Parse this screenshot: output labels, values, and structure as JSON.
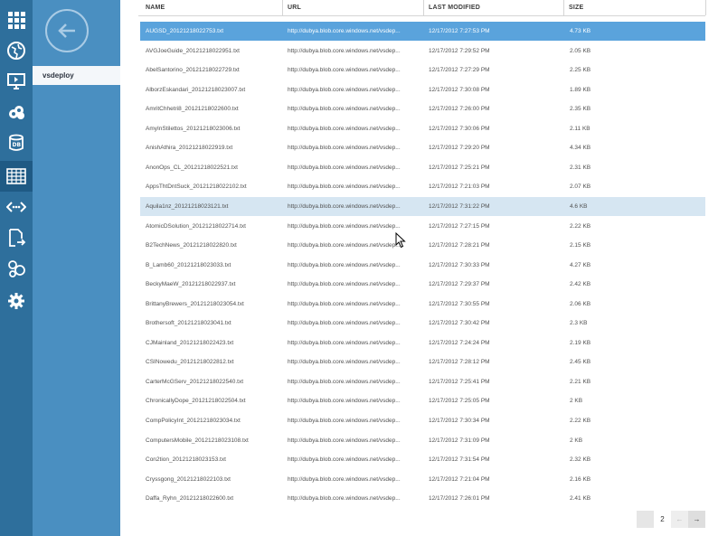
{
  "nav": {
    "items": [
      {
        "name": "all-items-icon"
      },
      {
        "name": "web-sites-icon"
      },
      {
        "name": "virtual-machines-icon"
      },
      {
        "name": "cloud-services-icon"
      },
      {
        "name": "sql-databases-icon"
      },
      {
        "name": "storage-icon"
      },
      {
        "name": "networks-icon"
      },
      {
        "name": "import-export-icon"
      },
      {
        "name": "hdinsight-icon"
      },
      {
        "name": "settings-icon"
      }
    ]
  },
  "sidebar": {
    "selected_item": "vsdeploy"
  },
  "table": {
    "columns": [
      "NAME",
      "URL",
      "LAST MODIFIED",
      "SIZE"
    ],
    "rows": [
      {
        "name": "AUGSD_20121218022753.txt",
        "url": "http://dubya.blob.core.windows.net/vsdep...",
        "modified": "12/17/2012 7:27:53 PM",
        "size": "4.73 KB"
      },
      {
        "name": "AVGJoeGuide_20121218022951.txt",
        "url": "http://dubya.blob.core.windows.net/vsdep...",
        "modified": "12/17/2012 7:29:52 PM",
        "size": "2.05 KB"
      },
      {
        "name": "AbelSantorino_20121218022729.txt",
        "url": "http://dubya.blob.core.windows.net/vsdep...",
        "modified": "12/17/2012 7:27:29 PM",
        "size": "2.25 KB"
      },
      {
        "name": "AlborzEskandari_20121218023007.txt",
        "url": "http://dubya.blob.core.windows.net/vsdep...",
        "modified": "12/17/2012 7:30:08 PM",
        "size": "1.89 KB"
      },
      {
        "name": "AmritChhetri8_20121218022600.txt",
        "url": "http://dubya.blob.core.windows.net/vsdep...",
        "modified": "12/17/2012 7:26:00 PM",
        "size": "2.35 KB"
      },
      {
        "name": "AmyInStilettos_20121218023006.txt",
        "url": "http://dubya.blob.core.windows.net/vsdep...",
        "modified": "12/17/2012 7:30:06 PM",
        "size": "2.11 KB"
      },
      {
        "name": "AnishAthira_20121218022919.txt",
        "url": "http://dubya.blob.core.windows.net/vsdep...",
        "modified": "12/17/2012 7:29:20 PM",
        "size": "4.34 KB"
      },
      {
        "name": "AnonOps_CL_20121218022521.txt",
        "url": "http://dubya.blob.core.windows.net/vsdep...",
        "modified": "12/17/2012 7:25:21 PM",
        "size": "2.31 KB"
      },
      {
        "name": "AppsThtDntSuck_20121218022102.txt",
        "url": "http://dubya.blob.core.windows.net/vsdep...",
        "modified": "12/17/2012 7:21:03 PM",
        "size": "2.07 KB"
      },
      {
        "name": "Aquila1nz_20121218023121.txt",
        "url": "http://dubya.blob.core.windows.net/vsdep...",
        "modified": "12/17/2012 7:31:22 PM",
        "size": "4.6 KB"
      },
      {
        "name": "AtomicDSolution_20121218022714.txt",
        "url": "http://dubya.blob.core.windows.net/vsdep...",
        "modified": "12/17/2012 7:27:15 PM",
        "size": "2.22 KB"
      },
      {
        "name": "B2TechNews_20121218022820.txt",
        "url": "http://dubya.blob.core.windows.net/vsdep...",
        "modified": "12/17/2012 7:28:21 PM",
        "size": "2.15 KB"
      },
      {
        "name": "B_Lamb60_20121218023033.txt",
        "url": "http://dubya.blob.core.windows.net/vsdep...",
        "modified": "12/17/2012 7:30:33 PM",
        "size": "4.27 KB"
      },
      {
        "name": "BeckyMaeW_20121218022937.txt",
        "url": "http://dubya.blob.core.windows.net/vsdep...",
        "modified": "12/17/2012 7:29:37 PM",
        "size": "2.42 KB"
      },
      {
        "name": "BrittanyBrewers_20121218023054.txt",
        "url": "http://dubya.blob.core.windows.net/vsdep...",
        "modified": "12/17/2012 7:30:55 PM",
        "size": "2.06 KB"
      },
      {
        "name": "Brothersoft_20121218023041.txt",
        "url": "http://dubya.blob.core.windows.net/vsdep...",
        "modified": "12/17/2012 7:30:42 PM",
        "size": "2.3 KB"
      },
      {
        "name": "CJMainland_20121218022423.txt",
        "url": "http://dubya.blob.core.windows.net/vsdep...",
        "modified": "12/17/2012 7:24:24 PM",
        "size": "2.19 KB"
      },
      {
        "name": "CSINowedu_20121218022812.txt",
        "url": "http://dubya.blob.core.windows.net/vsdep...",
        "modified": "12/17/2012 7:28:12 PM",
        "size": "2.45 KB"
      },
      {
        "name": "CarterMcGServ_20121218022540.txt",
        "url": "http://dubya.blob.core.windows.net/vsdep...",
        "modified": "12/17/2012 7:25:41 PM",
        "size": "2.21 KB"
      },
      {
        "name": "ChronicallyDope_20121218022504.txt",
        "url": "http://dubya.blob.core.windows.net/vsdep...",
        "modified": "12/17/2012 7:25:05 PM",
        "size": "2 KB"
      },
      {
        "name": "CompPolicyInt_20121218023034.txt",
        "url": "http://dubya.blob.core.windows.net/vsdep...",
        "modified": "12/17/2012 7:30:34 PM",
        "size": "2.22 KB"
      },
      {
        "name": "ComputersMobile_20121218023108.txt",
        "url": "http://dubya.blob.core.windows.net/vsdep...",
        "modified": "12/17/2012 7:31:09 PM",
        "size": "2 KB"
      },
      {
        "name": "Con2tion_20121218023153.txt",
        "url": "http://dubya.blob.core.windows.net/vsdep...",
        "modified": "12/17/2012 7:31:54 PM",
        "size": "2.32 KB"
      },
      {
        "name": "Cryssgong_20121218022103.txt",
        "url": "http://dubya.blob.core.windows.net/vsdep...",
        "modified": "12/17/2012 7:21:04 PM",
        "size": "2.16 KB"
      },
      {
        "name": "Daffa_Ryhn_20121218022600.txt",
        "url": "http://dubya.blob.core.windows.net/vsdep...",
        "modified": "12/17/2012 7:26:01 PM",
        "size": "2.41 KB"
      }
    ],
    "selected_index": 0,
    "hover_index": 9
  },
  "pager": {
    "page": "2",
    "prev_label": "←",
    "next_label": "→"
  },
  "colors": {
    "nav_bg": "#2e6f9c",
    "panel_bg": "#4a8fc1",
    "selected_row": "#5aa3dc",
    "hover_row": "#d6e6f2"
  }
}
